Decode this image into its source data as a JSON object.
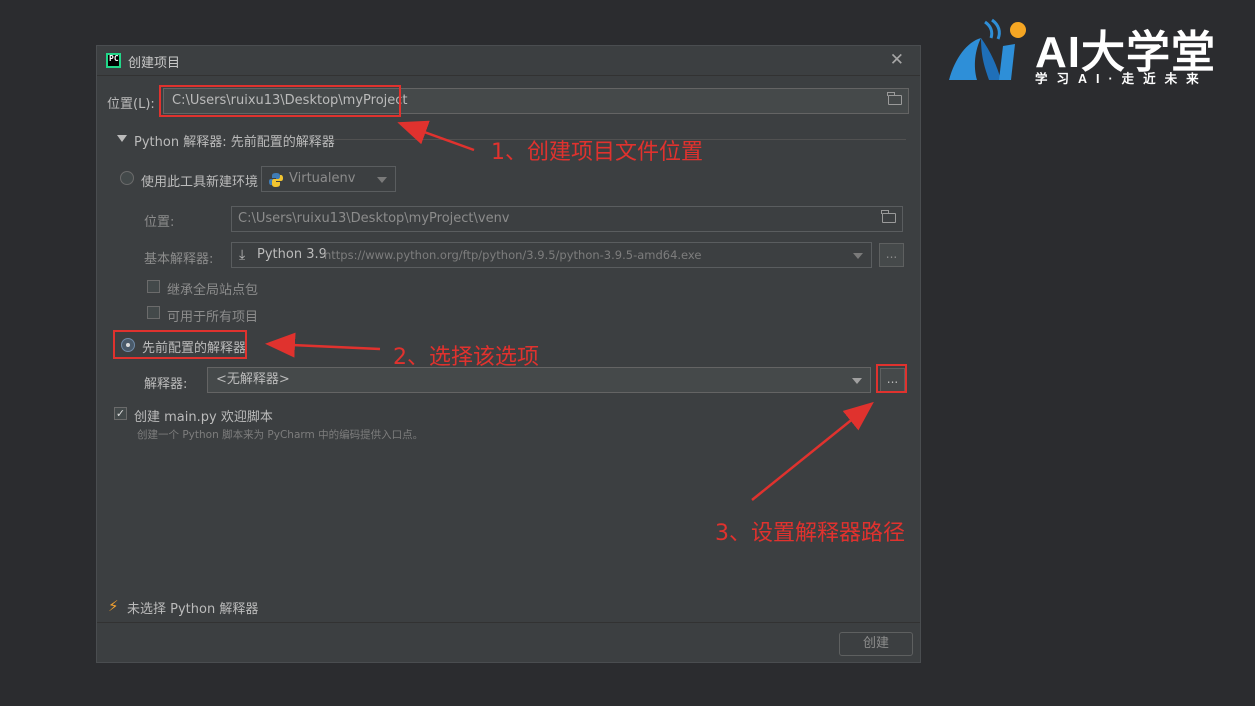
{
  "logo": {
    "title": "AI大学堂",
    "subtitle": "学习AI·走近未来"
  },
  "dialog": {
    "title": "创建项目",
    "location_label": "位置(L):",
    "location_value": "C:\\Users\\ruixu13\\Desktop\\myProject",
    "interpreter_section": "Python 解释器: 先前配置的解释器",
    "new_env_radio": "使用此工具新建环境",
    "env_tool": "Virtualenv",
    "env_location_label": "位置:",
    "env_location_value": "C:\\Users\\ruixu13\\Desktop\\myProject\\venv",
    "base_interpreter_label": "基本解释器:",
    "base_interpreter_name": "Python 3.9",
    "base_interpreter_url": "https://www.python.org/ftp/python/3.9.5/python-3.9.5-amd64.exe",
    "ellipsis": "...",
    "inherit_global": "继承全局站点包",
    "available_all": "可用于所有项目",
    "previous_radio": "先前配置的解释器",
    "interpreter_label": "解释器:",
    "interpreter_value": "<无解释器>",
    "create_main_label": "创建 main.py 欢迎脚本",
    "create_main_hint": "创建一个 Python 脚本来为 PyCharm 中的编码提供入口点。",
    "warning_text": "未选择 Python 解释器",
    "create_button": "创建"
  },
  "annotations": {
    "step1": "1、创建项目文件位置",
    "step2": "2、选择该选项",
    "step3": "3、设置解释器路径"
  },
  "colors": {
    "annotation": "#e0322e",
    "background": "#2b2c2f",
    "dialog": "#3c3f41"
  },
  "state": {
    "new_env_selected": false,
    "previous_selected": true,
    "create_main_checked": true,
    "inherit_global_checked": false,
    "available_all_checked": false
  }
}
